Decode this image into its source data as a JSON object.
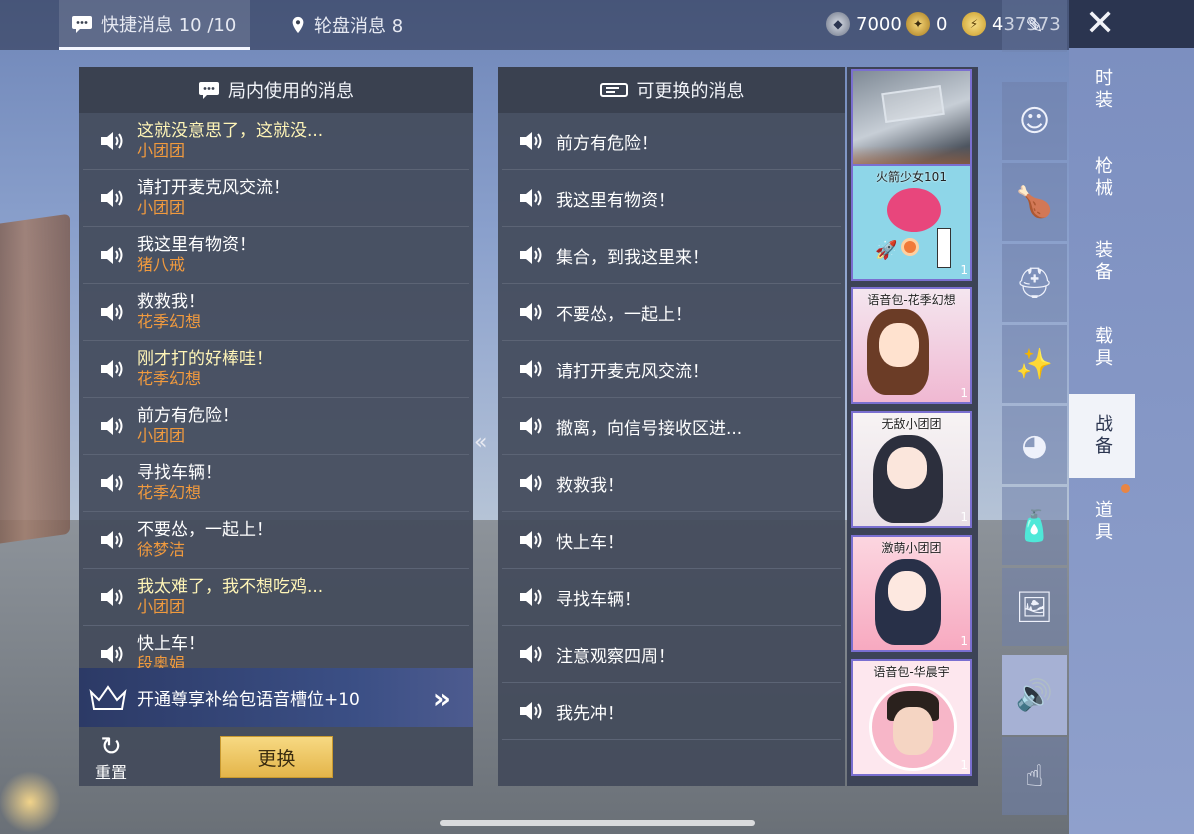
{
  "tabs": {
    "quick": "快捷消息 10 /10",
    "wheel": "轮盘消息 8"
  },
  "currency": [
    {
      "icon": "ag-coin-icon",
      "value": "7000"
    },
    {
      "icon": "token-icon",
      "value": "0"
    },
    {
      "icon": "bp-coin-icon",
      "value": "437373"
    }
  ],
  "left_panel": {
    "title": "局内使用的消息",
    "messages": [
      {
        "text": "这就没意思了，这就没...",
        "source": "小团团"
      },
      {
        "text": "请打开麦克风交流！",
        "source": "小团团"
      },
      {
        "text": "我这里有物资！",
        "source": "猪八戒"
      },
      {
        "text": "救救我！",
        "source": "花季幻想"
      },
      {
        "text": "刚才打的好棒哇！",
        "source": "花季幻想"
      },
      {
        "text": "前方有危险！",
        "source": "小团团"
      },
      {
        "text": "寻找车辆！",
        "source": "花季幻想"
      },
      {
        "text": "不要怂，一起上！",
        "source": "徐梦洁"
      },
      {
        "text": "我太难了，我不想吃鸡...",
        "source": "小团团"
      },
      {
        "text": "快上车！",
        "source": "段奥娟"
      }
    ],
    "promo": "开通尊享补给包语音槽位+10",
    "reset": "重置",
    "swap": "更换"
  },
  "mid_panel": {
    "title": "可更换的消息",
    "messages": [
      "前方有危险！",
      "我这里有物资！",
      "集合，到我这里来！",
      "不要怂，一起上！",
      "请打开麦克风交流！",
      "撤离，向信号接收区进...",
      "救救我！",
      "快上车！",
      "寻找车辆！",
      "注意观察四周！",
      "我先冲！"
    ]
  },
  "packs": [
    {
      "label": "",
      "count": "1"
    },
    {
      "label": "火箭少女101",
      "count": "1"
    },
    {
      "label": "语音包-花季幻想",
      "count": "1"
    },
    {
      "label": "无敌小团团",
      "count": "1"
    },
    {
      "label": "激萌小团团",
      "count": "1"
    },
    {
      "label": "语音包-华晨宇",
      "count": "1"
    }
  ],
  "icon_column": [
    "hat-icon",
    "face-icon",
    "food-icon",
    "helmet-icon",
    "magic-wand-icon",
    "emote-icon",
    "spray-icon",
    "photo-icon",
    "speaker-icon",
    "tap-icon"
  ],
  "nav": [
    "时装",
    "枪械",
    "装备",
    "载具",
    "战备",
    "道具"
  ],
  "colors": {
    "highlight_text": "#fff5b7",
    "source_text": "#f19a3e",
    "button_gold": "#e4b54a"
  }
}
